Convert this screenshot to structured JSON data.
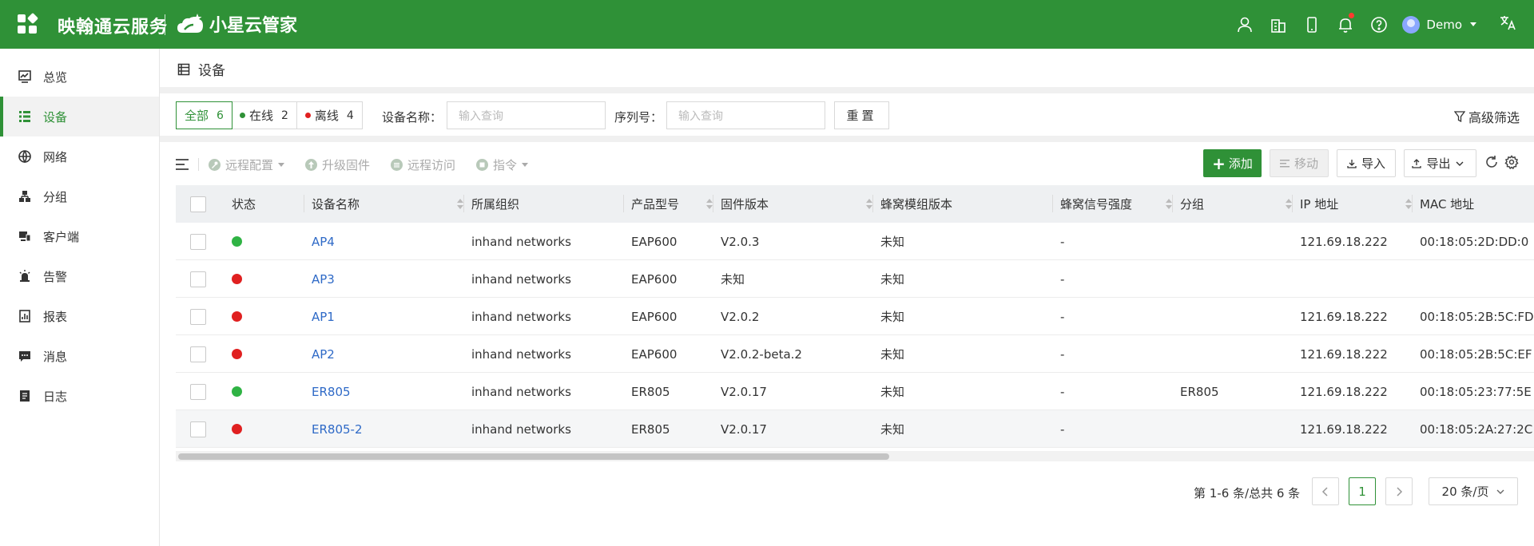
{
  "header": {
    "brand": "映翰通云服务",
    "product": "小星云管家",
    "user": "Demo",
    "lang": "文A",
    "color": "#2f9137"
  },
  "sidebar": {
    "items": [
      {
        "label": "总览",
        "icon": "chart-icon"
      },
      {
        "label": "设备",
        "icon": "list-icon",
        "active": true
      },
      {
        "label": "网络",
        "icon": "globe-icon"
      },
      {
        "label": "分组",
        "icon": "group-icon"
      },
      {
        "label": "客户端",
        "icon": "client-icon"
      },
      {
        "label": "告警",
        "icon": "alarm-icon"
      },
      {
        "label": "报表",
        "icon": "report-icon"
      },
      {
        "label": "消息",
        "icon": "message-icon"
      },
      {
        "label": "日志",
        "icon": "log-icon"
      }
    ]
  },
  "page": {
    "title": "设备"
  },
  "filters": {
    "tabs": [
      {
        "label": "全部",
        "count": "6"
      },
      {
        "label": "在线",
        "count": "2"
      },
      {
        "label": "离线",
        "count": "4"
      }
    ],
    "name_label": "设备名称：",
    "name_placeholder": "输入查询",
    "serial_label": "序列号：",
    "serial_placeholder": "输入查询",
    "reset": "重置",
    "advanced": "高级筛选"
  },
  "toolbar": {
    "remote_config": "远程配置",
    "upgrade": "升级固件",
    "remote_access": "远程访问",
    "command": "指令",
    "add": "添加",
    "move": "移动",
    "import": "导入",
    "export": "导出"
  },
  "table": {
    "headers": [
      "状态",
      "设备名称",
      "所属组织",
      "产品型号",
      "固件版本",
      "蜂窝模组版本",
      "蜂窝信号强度",
      "分组",
      "IP 地址",
      "MAC 地址"
    ],
    "rows": [
      {
        "status": "online",
        "name": "AP4",
        "org": "inhand networks",
        "model": "EAP600",
        "firmware": "V2.0.3",
        "cell_module": "未知",
        "signal": "-",
        "group": "",
        "ip": "121.69.18.222",
        "mac": "00:18:05:2D:DD:0"
      },
      {
        "status": "offline",
        "name": "AP3",
        "org": "inhand networks",
        "model": "EAP600",
        "firmware": "未知",
        "cell_module": "未知",
        "signal": "-",
        "group": "",
        "ip": "",
        "mac": ""
      },
      {
        "status": "offline",
        "name": "AP1",
        "org": "inhand networks",
        "model": "EAP600",
        "firmware": "V2.0.2",
        "cell_module": "未知",
        "signal": "-",
        "group": "",
        "ip": "121.69.18.222",
        "mac": "00:18:05:2B:5C:FD"
      },
      {
        "status": "offline",
        "name": "AP2",
        "org": "inhand networks",
        "model": "EAP600",
        "firmware": "V2.0.2-beta.2",
        "cell_module": "未知",
        "signal": "-",
        "group": "",
        "ip": "121.69.18.222",
        "mac": "00:18:05:2B:5C:EF"
      },
      {
        "status": "online",
        "name": "ER805",
        "org": "inhand networks",
        "model": "ER805",
        "firmware": "V2.0.17",
        "cell_module": "未知",
        "signal": "-",
        "group": "ER805",
        "ip": "121.69.18.222",
        "mac": "00:18:05:23:77:5E"
      },
      {
        "status": "offline",
        "name": "ER805-2",
        "org": "inhand networks",
        "model": "ER805",
        "firmware": "V2.0.17",
        "cell_module": "未知",
        "signal": "-",
        "group": "",
        "ip": "121.69.18.222",
        "mac": "00:18:05:2A:27:2C"
      }
    ]
  },
  "pagination": {
    "summary": "第 1-6 条/总共 6 条",
    "current": "1",
    "page_size": "20 条/页"
  },
  "colors": {
    "online": "#2fb344",
    "offline": "#e02020",
    "link": "#2f6ac7"
  }
}
